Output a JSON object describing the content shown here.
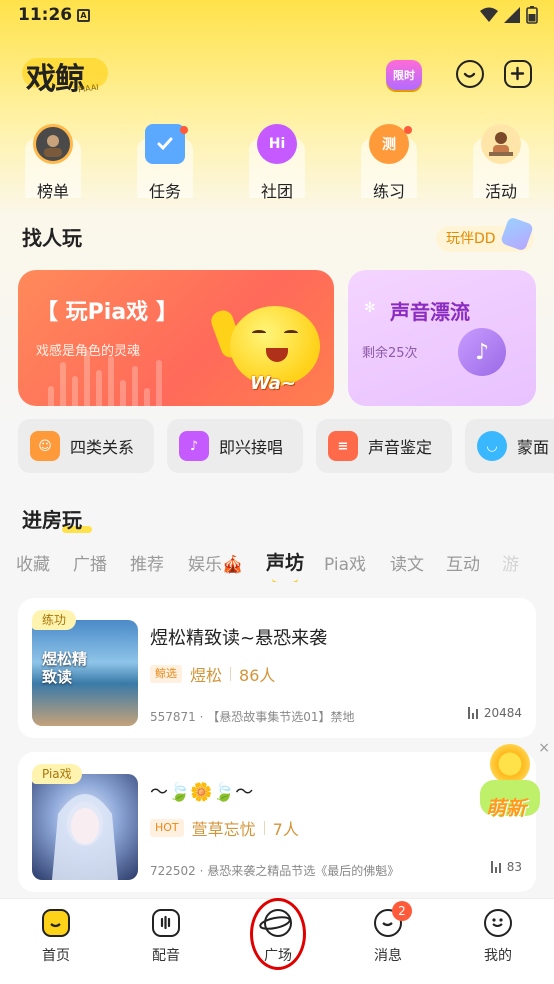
{
  "status_bar": {
    "time": "11:26",
    "sim": "A"
  },
  "header": {
    "logo_text": "戏鲸",
    "logo_sub": "PIAAI",
    "limited_label": "限时"
  },
  "entries": [
    {
      "label": "榜单",
      "icon": "ranking-icon",
      "color": "#ffb84a"
    },
    {
      "label": "任务",
      "icon": "task-icon",
      "color": "#5aa8ff",
      "dot": true
    },
    {
      "label": "社团",
      "icon": "club-icon",
      "color": "#c45aff",
      "badge": "Hi"
    },
    {
      "label": "练习",
      "icon": "practice-icon",
      "color": "#ff9a3a",
      "dot": true,
      "badge": "测"
    },
    {
      "label": "活动",
      "icon": "event-icon",
      "color": "#ffcf5a"
    }
  ],
  "find_section": {
    "title": "找人玩",
    "partner_label": "玩伴DD"
  },
  "pia_card": {
    "title": "【 玩Pia戏 】",
    "desc": "戏感是角色的灵魂",
    "wa_text": "Wa~"
  },
  "voice_card": {
    "title": "声音漂流",
    "remain": "剩余25次"
  },
  "chips": [
    {
      "label": "四类关系",
      "color": "#ff9a3a",
      "icon": "relation-icon"
    },
    {
      "label": "即兴接唱",
      "color": "#c45aff",
      "icon": "music-icon"
    },
    {
      "label": "声音鉴定",
      "color": "#ff6a4a",
      "icon": "certify-icon"
    },
    {
      "label": "蒙面",
      "color": "#3ab8ff",
      "icon": "mask-icon"
    }
  ],
  "room_section": {
    "title": "进房玩"
  },
  "tabs": [
    "收藏",
    "广播",
    "推荐",
    "娱乐🎪",
    "声坊",
    "Pia戏",
    "读文",
    "互动",
    "游"
  ],
  "active_tab": "声坊",
  "rooms": [
    {
      "tag": "练功",
      "cover_text": "煜松精致读",
      "title": "煜松精致读~悬恐来袭",
      "badge": "鲸选",
      "host": "煜松",
      "people": "86人",
      "info": "557871 · 【悬恐故事集节选01】禁地",
      "count": "20484"
    },
    {
      "tag": "Pia戏",
      "title": "〜🍃🌼🍃〜",
      "badge": "HOT",
      "host": "萱草忘忧",
      "people": "7人",
      "info": "722502 · 悬恐来袭之精品节选《最后的佛魁》",
      "count": "83"
    }
  ],
  "float_ad": {
    "label": "萌新",
    "close": "×"
  },
  "bottom_nav": [
    {
      "label": "首页"
    },
    {
      "label": "配音"
    },
    {
      "label": "广场"
    },
    {
      "label": "消息",
      "badge": "2"
    },
    {
      "label": "我的"
    }
  ]
}
